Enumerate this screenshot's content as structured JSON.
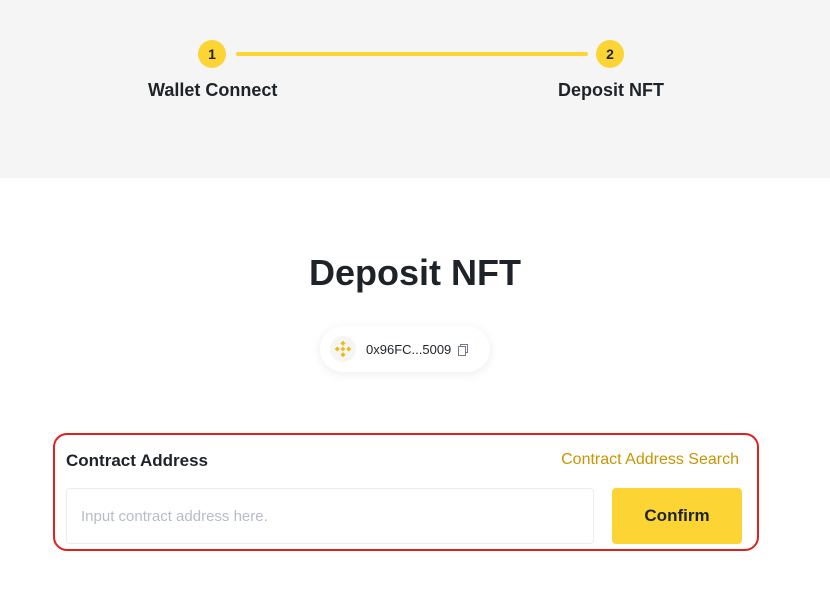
{
  "stepper": {
    "steps": [
      {
        "number": "1",
        "label": "Wallet Connect"
      },
      {
        "number": "2",
        "label": "Deposit NFT"
      }
    ]
  },
  "main": {
    "title": "Deposit NFT",
    "wallet": {
      "address": "0x96FC...5009",
      "chain_icon": "bnb-icon",
      "copy_icon": "copy-icon"
    },
    "form": {
      "label": "Contract Address",
      "search_link": "Contract Address Search",
      "input_value": "",
      "input_placeholder": "Input contract address here.",
      "confirm_label": "Confirm"
    }
  },
  "colors": {
    "accent": "#fcd535",
    "link": "#c99400",
    "highlight_border": "#e02020",
    "band": "#f5f5f5"
  }
}
